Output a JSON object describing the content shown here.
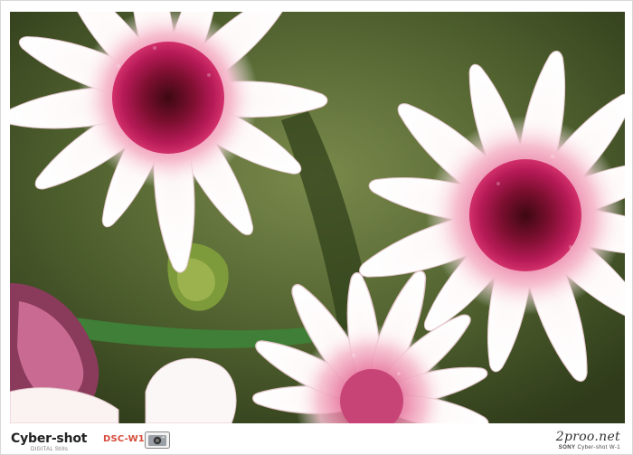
{
  "photo": {
    "subject": "pink-and-white-chrysanthemums",
    "palette": {
      "petal": "#fbf4f3",
      "petal_shade": "#e9c9cf",
      "center": "#b51a56",
      "center_dark": "#5a0a1f",
      "foliage": "#4d5e2d",
      "stem": "#3f7f37"
    }
  },
  "footer": {
    "brand": "Cyber-shot",
    "brand_sub": "DIGITAL  Stills",
    "model": "DSC-W1",
    "camera_icon": "camera-icon",
    "site": "2proo.net",
    "credit_maker": "SONY",
    "credit_model": "Cyber-shot W-1"
  }
}
